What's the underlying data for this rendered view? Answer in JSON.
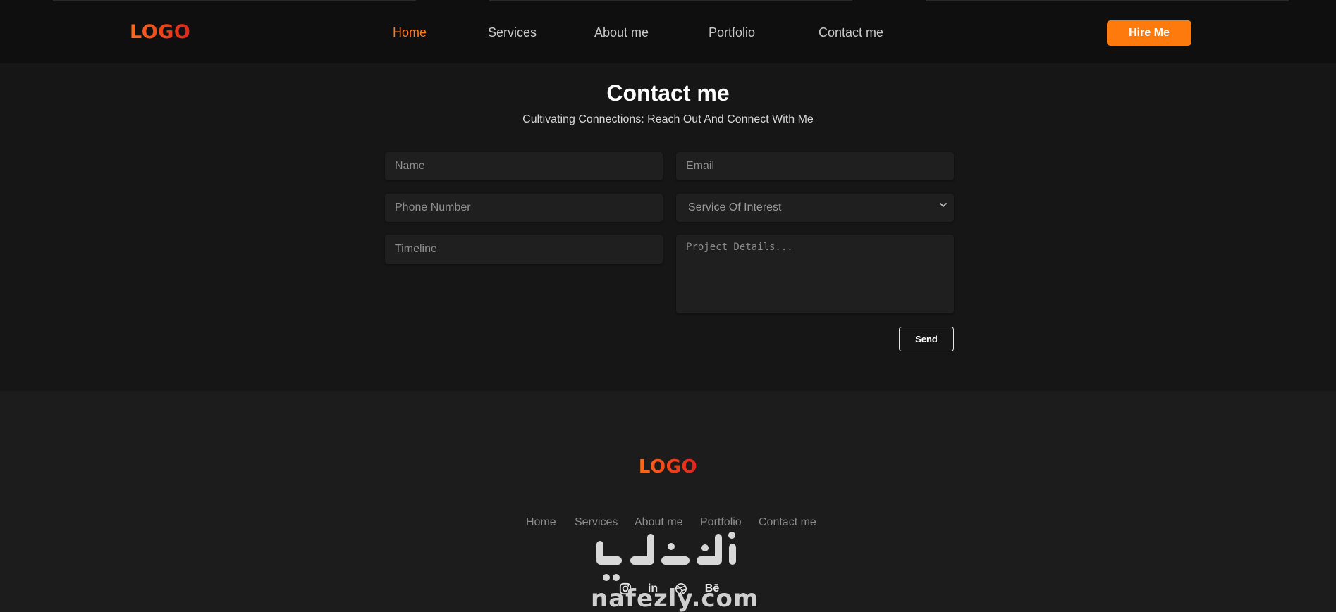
{
  "header": {
    "logo": "LOGO",
    "nav": [
      {
        "label": "Home",
        "active": true
      },
      {
        "label": "Services",
        "active": false
      },
      {
        "label": "About me",
        "active": false
      },
      {
        "label": "Portfolio",
        "active": false
      },
      {
        "label": "Contact me",
        "active": false
      }
    ],
    "hire_label": "Hire Me"
  },
  "contact": {
    "title": "Contact me",
    "subtitle": "Cultivating Connections: Reach Out And Connect With Me",
    "fields": {
      "name_placeholder": "Name",
      "email_placeholder": "Email",
      "phone_placeholder": "Phone Number",
      "service_selected": "Service Of Interest",
      "timeline_placeholder": "Timeline",
      "details_placeholder": "Project Details..."
    },
    "send_label": "Send"
  },
  "footer": {
    "logo": "LOGO",
    "nav": [
      "Home",
      "Services",
      "About me",
      "Portfolio",
      "Contact me"
    ],
    "socials": [
      "instagram-icon",
      "linkedin-icon",
      "dribbble-icon",
      "behance-icon"
    ],
    "behance_text": "Bē",
    "linkedin_text": "in"
  },
  "watermark": {
    "latin": "nafezly.com"
  },
  "colors": {
    "accent": "#ff7a0c",
    "active_nav": "#ff7a1a",
    "background": "#161616",
    "header_bg": "#0f0f0f",
    "footer_bg": "#1c1c1c",
    "field_bg": "#1f1f1f"
  }
}
